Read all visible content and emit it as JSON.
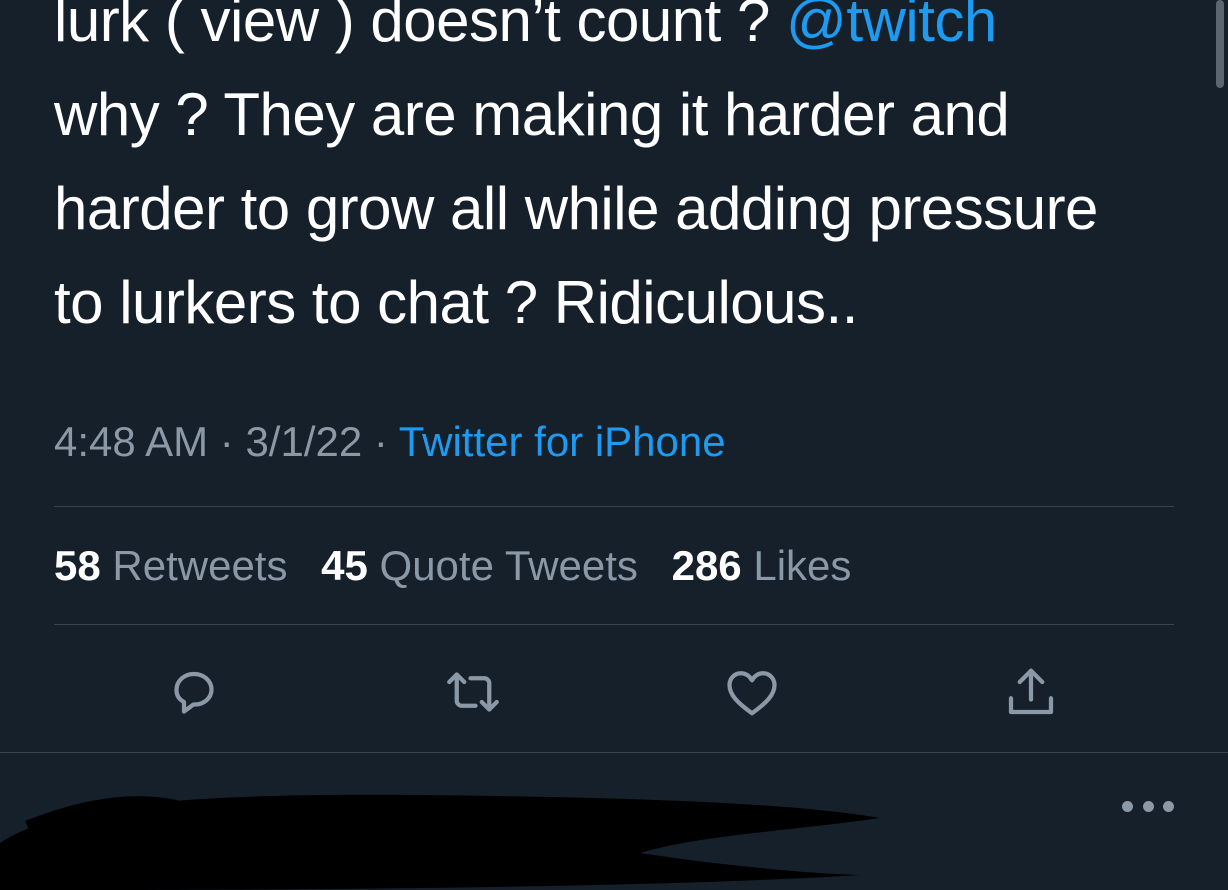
{
  "tweet": {
    "lines": {
      "l1_text": "lurk ( view ) doesn’t count ? ",
      "l1_mention": "@twitch",
      "l2": "why ? They are making it harder and",
      "l3": "harder to grow all while  adding pressure",
      "l4": "to lurkers to chat ? Ridiculous.."
    },
    "time": "4:48 AM",
    "separator": " · ",
    "date": "3/1/22",
    "source": "Twitter for iPhone"
  },
  "stats": {
    "retweets_count": "58",
    "retweets_label": "Retweets",
    "quotes_count": "45",
    "quotes_label": "Quote Tweets",
    "likes_count": "286",
    "likes_label": "Likes"
  },
  "actions": {
    "icons": [
      "reply-icon",
      "retweet-icon",
      "like-icon",
      "share-icon"
    ]
  },
  "next_tweet": {
    "more_icon": "more-options-icon"
  },
  "colors": {
    "background": "#15202b",
    "text": "#ffffff",
    "secondary": "#8b98a5",
    "accent": "#1d9bf0",
    "divider": "#38444d"
  }
}
